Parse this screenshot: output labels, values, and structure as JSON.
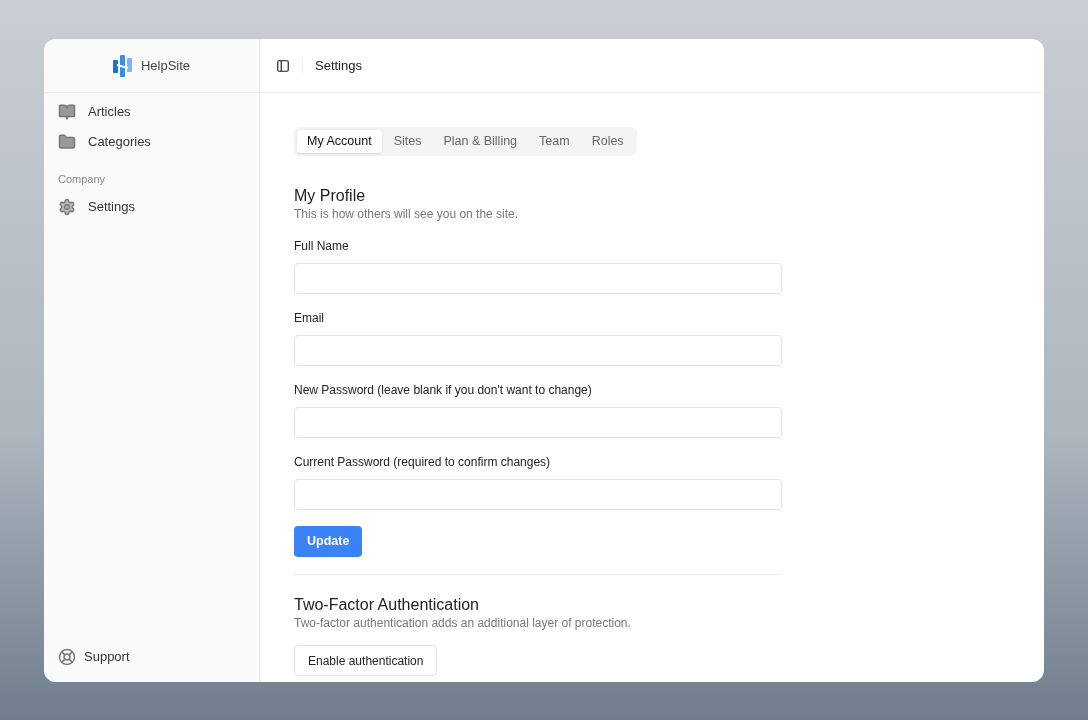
{
  "brand": {
    "name": "HelpSite"
  },
  "sidebar": {
    "items": [
      {
        "label": "Articles",
        "kind": "book"
      },
      {
        "label": "Categories",
        "kind": "folder"
      }
    ],
    "section": "Company",
    "section_items": [
      {
        "label": "Settings",
        "kind": "gear"
      }
    ],
    "footer": {
      "label": "Support",
      "kind": "support"
    }
  },
  "header": {
    "title": "Settings"
  },
  "tabs": [
    {
      "label": "My Account",
      "selected": true
    },
    {
      "label": "Sites",
      "selected": false
    },
    {
      "label": "Plan & Billing",
      "selected": false
    },
    {
      "label": "Team",
      "selected": false
    },
    {
      "label": "Roles",
      "selected": false
    }
  ],
  "profile": {
    "title": "My Profile",
    "subtitle": "This is how others will see you on the site.",
    "fields": [
      {
        "label": "Full Name"
      },
      {
        "label": "Email"
      },
      {
        "label": "New Password (leave blank if you don't want to change)"
      },
      {
        "label": "Current Password (required to confirm changes)"
      }
    ],
    "button": "Update"
  },
  "two_factor": {
    "title": "Two-Factor Authentication",
    "subtitle": "Two-factor authentication adds an additional layer of protection.",
    "button": "Enable authentication"
  }
}
